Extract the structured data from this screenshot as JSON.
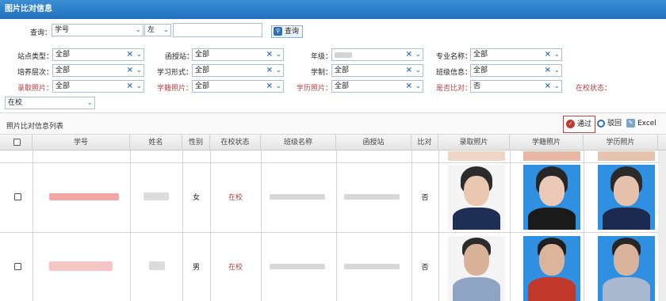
{
  "window": {
    "title": "图片比对信息"
  },
  "query": {
    "label": "查询：",
    "field_value": "学号",
    "operator_value": "左",
    "text_value": "",
    "search_label": "查询"
  },
  "filters": {
    "station_label": "站点类型：",
    "station_value": "全部",
    "center_label": "函授站：",
    "center_value": "全部",
    "grade_label": "年级：",
    "grade_value": "",
    "major_label": "专业名称：",
    "major_value": "全部",
    "level_label": "培养层次：",
    "level_value": "全部",
    "study_label": "学习形式：",
    "study_value": "全部",
    "period_label": "学制：",
    "period_value": "全部",
    "class_label": "班级信息：",
    "class_value": "全部",
    "admission_label": "录取照片：",
    "admission_value": "全部",
    "enroll_label": "学籍照片：",
    "enroll_value": "全部",
    "degree_label": "学历照片：",
    "degree_value": "全部",
    "compared_label": "是否比对：",
    "compared_value": "否",
    "status_label": "在校状态：",
    "status_value": "在校"
  },
  "list": {
    "title": "照片比对信息列表",
    "pass_label": "通过",
    "reject_label": "驳回",
    "excel_label": "Excel"
  },
  "table": {
    "headers": [
      "学号",
      "姓名",
      "性别",
      "在校状态",
      "班级名称",
      "函授站",
      "比对",
      "录取照片",
      "学籍照片",
      "学历照片"
    ],
    "rows": [
      {
        "gender": "女",
        "status": "在校",
        "compared": "否"
      },
      {
        "gender": "男",
        "status": "在校",
        "compared": "否"
      }
    ]
  },
  "colors": {
    "titlebar": "#2a7bc8",
    "accent_blue": "#2e6fb8",
    "label_red": "#b04040",
    "photo_blue": "#2f8fe0"
  }
}
